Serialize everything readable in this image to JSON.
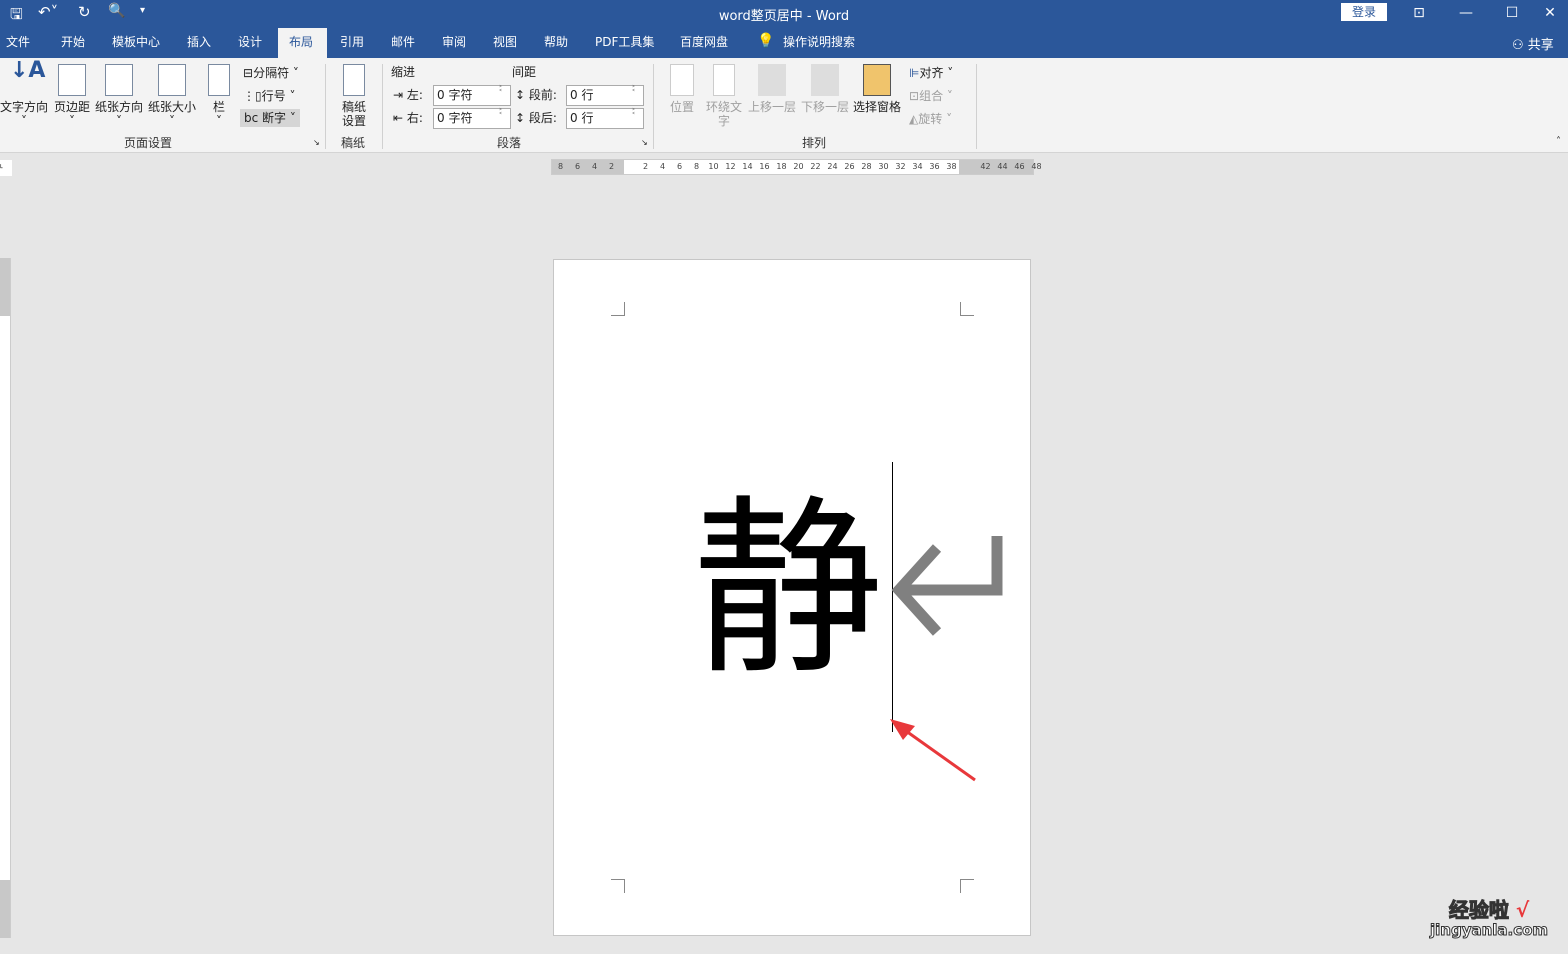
{
  "title": "word整页居中  -  Word",
  "quick_access": [
    "save-icon",
    "undo-icon",
    "redo-icon",
    "print-preview-icon",
    "customize-icon"
  ],
  "login_label": "登录",
  "share_label": "共享",
  "tabs": [
    "文件",
    "开始",
    "模板中心",
    "插入",
    "设计",
    "布局",
    "引用",
    "邮件",
    "审阅",
    "视图",
    "帮助",
    "PDF工具集",
    "百度网盘",
    "操作说明搜索"
  ],
  "active_tab": "布局",
  "ribbon": {
    "page_setup": {
      "label": "页面设置",
      "buttons": [
        "文字方向",
        "页边距",
        "纸张方向",
        "纸张大小",
        "栏"
      ],
      "small": [
        "分隔符",
        "行号",
        "断字"
      ]
    },
    "manuscript": {
      "label": "稿纸",
      "button": "稿纸\n设置",
      "btn1": "稿纸",
      "btn2": "设置"
    },
    "paragraph": {
      "label": "段落",
      "indent_label": "缩进",
      "spacing_label": "间距",
      "left_label": "左:",
      "left_value": "0 字符",
      "right_label": "右:",
      "right_value": "0 字符",
      "before_label": "段前:",
      "before_value": "0 行",
      "after_label": "段后:",
      "after_value": "0 行"
    },
    "arrange": {
      "label": "排列",
      "buttons": [
        "位置",
        "环绕文字",
        "上移一层",
        "下移一层",
        "选择窗格"
      ],
      "small": [
        "对齐",
        "组合",
        "旋转"
      ]
    }
  },
  "ruler_ticks": [
    "8",
    "6",
    "4",
    "2",
    "",
    "2",
    "4",
    "6",
    "8",
    "10",
    "12",
    "14",
    "16",
    "18",
    "20",
    "22",
    "24",
    "26",
    "28",
    "30",
    "32",
    "34",
    "36",
    "38",
    "",
    "42",
    "44",
    "46",
    "48"
  ],
  "document": {
    "text": "静"
  },
  "watermark": {
    "line1": "经验啦",
    "line2": "jingyanla.com"
  },
  "colors": {
    "titlebar": "#2b579a",
    "ribbon": "#f3f3f3",
    "arrow": "#e8383b"
  }
}
